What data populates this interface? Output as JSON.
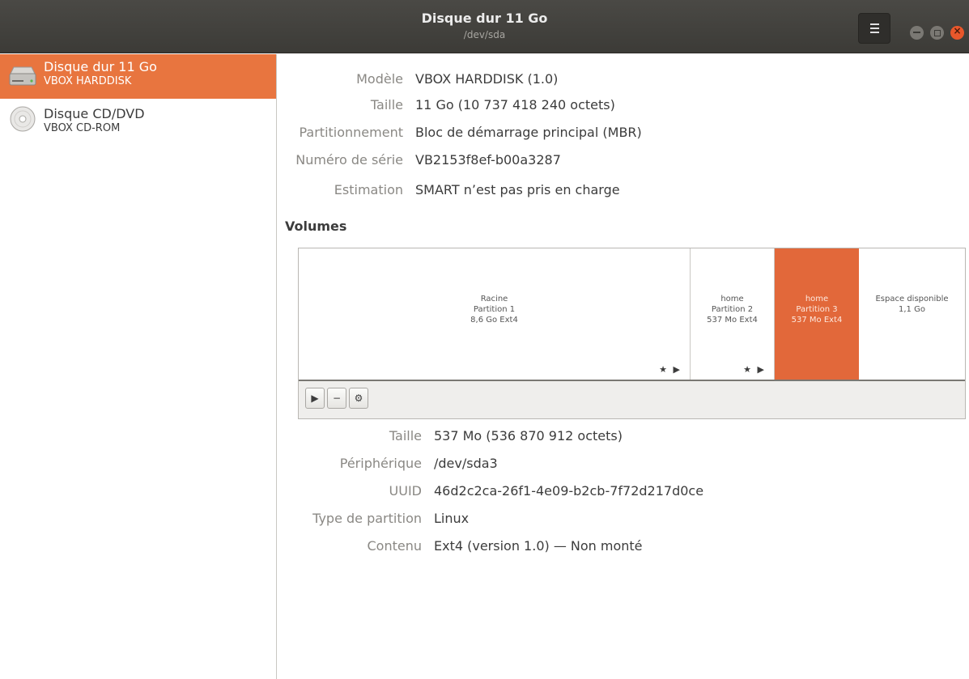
{
  "window": {
    "title": "Disque dur 11 Go",
    "subtitle": "/dev/sda",
    "menu_icon": "hamburger-menu-icon"
  },
  "sidebar": {
    "items": [
      {
        "name": "Disque dur 11 Go",
        "model": "VBOX HARDDISK",
        "icon": "hard-disk-icon",
        "selected": true
      },
      {
        "name": "Disque CD/DVD",
        "model": "VBOX CD-ROM",
        "icon": "optical-disc-icon",
        "selected": false
      }
    ]
  },
  "drive_info": {
    "rows": [
      {
        "label": "Modèle",
        "value": "VBOX HARDDISK (1.0)"
      },
      {
        "label": "Taille",
        "value": "11 Go (10 737 418 240 octets)"
      },
      {
        "label": "Partitionnement",
        "value": "Bloc de démarrage principal (MBR)"
      },
      {
        "label": "Numéro de série",
        "value": "VB2153f8ef-b00a3287"
      },
      {
        "label": "Estimation",
        "value": "SMART n’est pas pris en charge"
      }
    ]
  },
  "volumes": {
    "title": "Volumes",
    "segments": [
      {
        "line1": "Racine",
        "line2": "Partition 1",
        "line3": "8,6 Go Ext4",
        "flags": "★ ▶"
      },
      {
        "line1": "home",
        "line2": "Partition 2",
        "line3": "537 Mo Ext4",
        "flags": "★ ▶"
      },
      {
        "line1": "home",
        "line2": "Partition 3",
        "line3": "537 Mo Ext4",
        "selected": true
      },
      {
        "line1": "Espace disponible",
        "line2": "1,1 Go"
      }
    ],
    "toolbar": {
      "play": "▶",
      "minus": "−",
      "settings": "⚙"
    }
  },
  "partition_info": {
    "rows": [
      {
        "label": "Taille",
        "value": "537 Mo (536 870 912 octets)"
      },
      {
        "label": "Périphérique",
        "value": "/dev/sda3"
      },
      {
        "label": "UUID",
        "value": "46d2c2ca-26f1-4e09-b2cb-7f72d217d0ce"
      },
      {
        "label": "Type de partition",
        "value": "Linux"
      },
      {
        "label": "Contenu",
        "value": "Ext4 (version 1.0) — Non monté"
      }
    ]
  },
  "colors": {
    "accent": "#e8753f",
    "headerbar": "#3c3b37",
    "close_button": "#e9572b"
  }
}
